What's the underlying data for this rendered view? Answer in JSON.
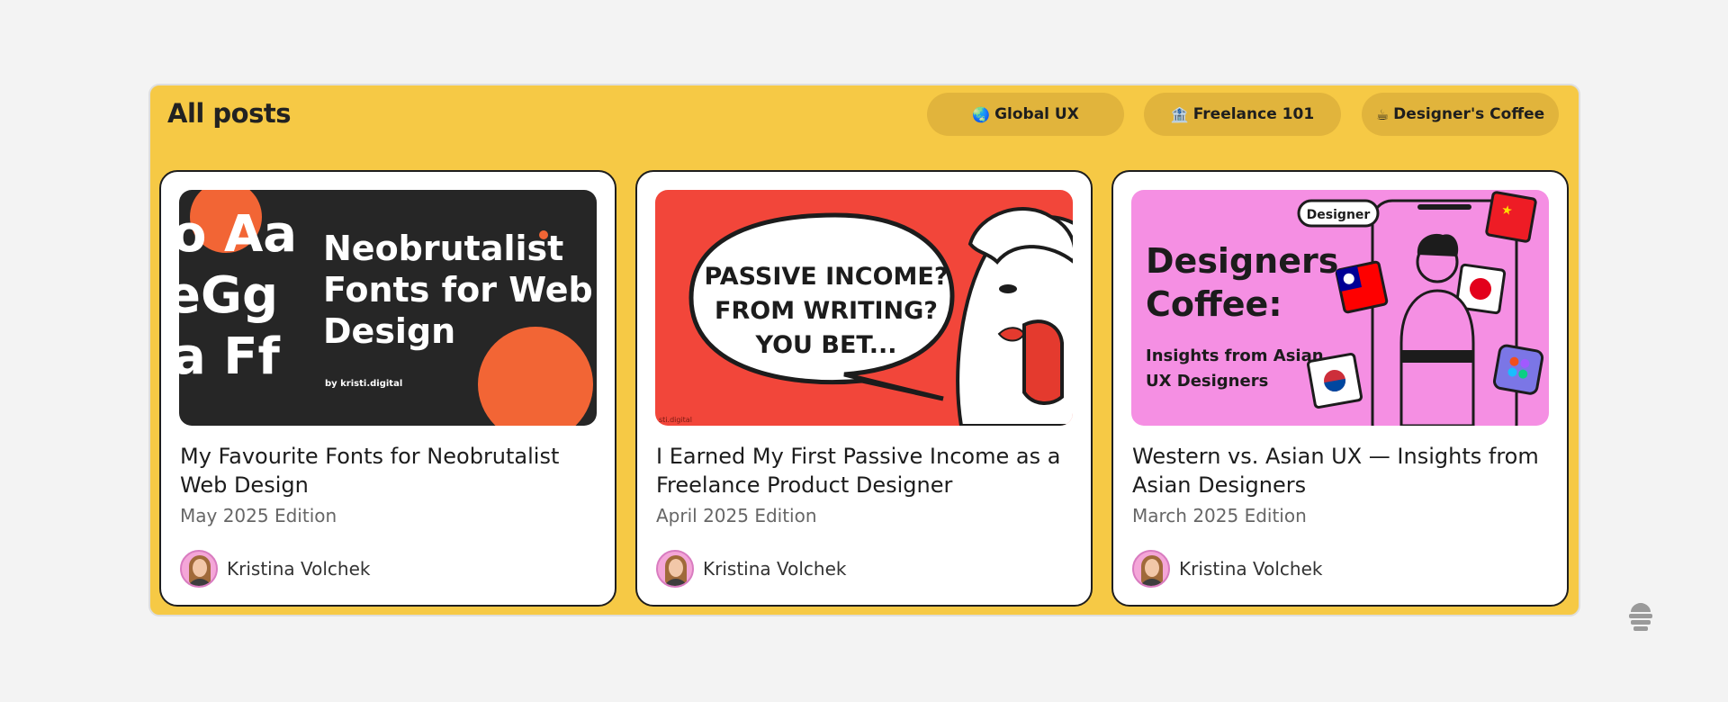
{
  "panel": {
    "title": "All posts"
  },
  "chips": [
    {
      "label": "Global UX",
      "emoji": "🌏"
    },
    {
      "label": "Freelance 101",
      "emoji": "🏦"
    },
    {
      "label": "Designer's Coffee",
      "emoji": "☕"
    }
  ],
  "posts": [
    {
      "title": "My Favourite Fonts for Neobrutalist Web Design",
      "date": "May 2025 Edition",
      "author": "Kristina Volchek",
      "thumb": {
        "headline": [
          "Neobrutalist",
          "Fonts for Web",
          "Design"
        ],
        "byline": "by kristi.digital",
        "specimen": [
          "Aa",
          "Gg",
          "Ff"
        ],
        "colors": {
          "bg": "#262626",
          "accent": "#f26535"
        }
      }
    },
    {
      "title": "I Earned My First Passive Income as a Freelance Product Designer",
      "date": "April 2025 Edition",
      "author": "Kristina Volchek",
      "thumb": {
        "bubble": [
          "PASSIVE INCOME?",
          "FROM WRITING?",
          "YOU BET..."
        ],
        "corner": "sti.digital",
        "colors": {
          "bg": "#f2463a",
          "bubble": "#ffffff"
        }
      }
    },
    {
      "title": "Western vs. Asian UX — Insights from Asian Designers",
      "date": "March 2025 Edition",
      "author": "Kristina Volchek",
      "thumb": {
        "tag": "Designer",
        "headline": [
          "Designers",
          "Coffee:"
        ],
        "sub": [
          "Insights from Asian",
          "UX Designers"
        ],
        "colors": {
          "bg": "#f58fe3"
        }
      }
    }
  ],
  "icons": {
    "corner": "stacked-layers-icon"
  }
}
